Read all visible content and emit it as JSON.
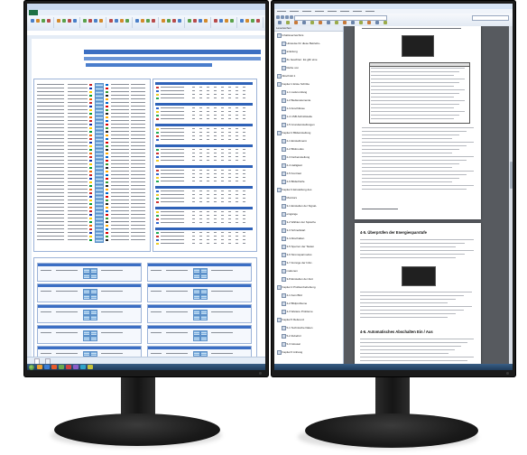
{
  "left_screen": {
    "taskbar_icon_colors": [
      "#f0a030",
      "#3d7fd6",
      "#e85a2a",
      "#6aa84f",
      "#d23f3f",
      "#8b5cc8",
      "#2fa3c7",
      "#c7c33a"
    ],
    "accent_colors": {
      "excel_green": "#1e7145",
      "table_blue": "#2f62b8",
      "banner_blue": "#3c6fc2"
    }
  },
  "right_screen": {
    "bookmarks_label": "Lesezeichen",
    "bookmarks": [
      "Inhaltsverzeichnis",
      "Hinweise für diese Betriebs-",
      "anleitung",
      "Zu beachten: Es gibt eine",
      "Reihe von",
      "Abschnitt 1",
      "Kapitel 1 Erste Schritte",
      "1-1 Lieferumfang",
      "1-2 Bedienelemente",
      "1-3 Anschlüsse",
      "1-4 USB-Schnittstelle",
      "1-5 Grundeinstellungen",
      "Kapitel 2 Bildeinstellung",
      "2-1 Einstellmenü",
      "2-2 Bildmodus",
      "2-3 Farbeinstellung",
      "2-4 Helligkeit",
      "2-5 Kontrast",
      "2-6 Bildschärfe",
      "Kapitel 3 Einstellung des",
      "Monitors",
      "3-1 Einstellen der Signal-",
      "eingänge",
      "3-2 Wählen der Sprache",
      "3-3 Schnellstart",
      "3-4 Abschalten",
      "3-5 Sperren der Tasten",
      "3-6 Stromsparmodus",
      "3-7 Anzeige der Infor-",
      "mationen",
      "3-8 Einstellen der Zeit",
      "Kapitel 4 Problembehebung",
      "4-1 Kein Bild",
      "4-2 Bildprobleme",
      "4-3 Weitere Probleme",
      "Kapitel 5 Referenz",
      "5-1 Technische Daten",
      "5-2 Zubehör",
      "5-3 Glossar",
      "Kapitel 6 Anhang"
    ],
    "page1_heading": "4-5. Überprüfen der Energiesparstufe",
    "page2_heading": "4-6. Automatisches Abschalten Ein / Aus",
    "accent_colors": {
      "viewer_bg": "#575a5f",
      "toolbar": "#e2e9f3"
    }
  }
}
